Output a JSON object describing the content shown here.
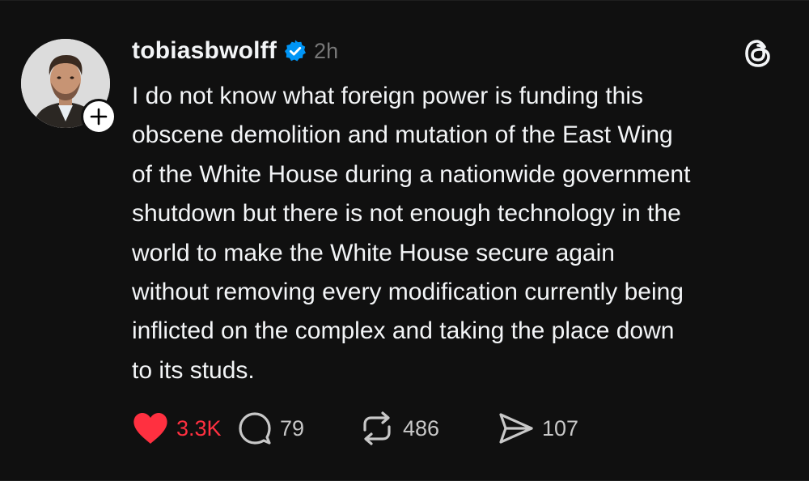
{
  "post": {
    "username": "tobiasbwolff",
    "timestamp": "2h",
    "lines": [
      "I do not know what foreign power is funding this",
      "obscene demolition and mutation of the East Wing",
      "of the White House during a nationwide government",
      "shutdown but there is not enough technology in the",
      "world to make the White House secure again",
      "without removing every modification currently being",
      "inflicted on the complex and taking the place down",
      "to its studs."
    ]
  },
  "actions": {
    "likes": "3.3K",
    "replies": "79",
    "reposts": "486",
    "shares": "107"
  },
  "icons": {
    "verified": "verified-badge-icon",
    "brand": "threads-logo-icon",
    "follow": "plus-icon",
    "like": "heart-icon",
    "reply": "speech-bubble-icon",
    "repost": "repost-arrows-icon",
    "share": "paper-plane-icon"
  },
  "colors": {
    "background": "#101010",
    "text": "#f3f5f7",
    "muted": "#777777",
    "liked": "#ff3040",
    "verified": "#0095f6"
  }
}
